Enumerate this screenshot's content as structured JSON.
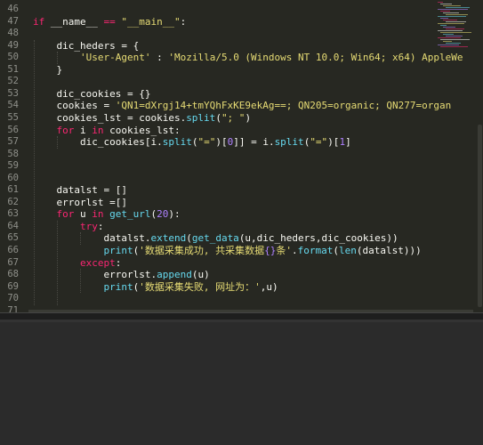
{
  "editor": {
    "lines": [
      {
        "n": "46",
        "segs": []
      },
      {
        "n": "47",
        "segs": [
          {
            "t": "if",
            "c": "kw"
          },
          {
            "t": " __name__ "
          },
          {
            "t": "==",
            "c": "kw"
          },
          {
            "t": " "
          },
          {
            "t": "\"__main__\"",
            "c": "str"
          },
          {
            "t": ":"
          }
        ]
      },
      {
        "n": "48",
        "segs": []
      },
      {
        "n": "49",
        "segs": [
          {
            "t": "    dic_heders = {"
          }
        ]
      },
      {
        "n": "50",
        "segs": [
          {
            "t": "        "
          },
          {
            "t": "'User-Agent'",
            "c": "str"
          },
          {
            "t": " : "
          },
          {
            "t": "'Mozilla/5.0 (Windows NT 10.0; Win64; x64) AppleWe",
            "c": "str"
          }
        ]
      },
      {
        "n": "51",
        "segs": [
          {
            "t": "    }"
          }
        ]
      },
      {
        "n": "52",
        "segs": []
      },
      {
        "n": "53",
        "segs": [
          {
            "t": "    dic_cookies = {}"
          }
        ]
      },
      {
        "n": "54",
        "segs": [
          {
            "t": "    cookies = "
          },
          {
            "t": "'QN1=dXrgj14+tmYQhFxKE9ekAg==; QN205=organic; QN277=organ",
            "c": "str"
          }
        ]
      },
      {
        "n": "55",
        "segs": [
          {
            "t": "    cookies_lst = cookies."
          },
          {
            "t": "split",
            "c": "fn"
          },
          {
            "t": "("
          },
          {
            "t": "\"; \"",
            "c": "str"
          },
          {
            "t": ")"
          }
        ]
      },
      {
        "n": "56",
        "segs": [
          {
            "t": "    "
          },
          {
            "t": "for",
            "c": "kw"
          },
          {
            "t": " i "
          },
          {
            "t": "in",
            "c": "kw"
          },
          {
            "t": " cookies_lst:"
          }
        ]
      },
      {
        "n": "57",
        "segs": [
          {
            "t": "        dic_cookies[i."
          },
          {
            "t": "split",
            "c": "fn"
          },
          {
            "t": "("
          },
          {
            "t": "\"=\"",
            "c": "str"
          },
          {
            "t": ")["
          },
          {
            "t": "0",
            "c": "num"
          },
          {
            "t": "]] = i."
          },
          {
            "t": "split",
            "c": "fn"
          },
          {
            "t": "("
          },
          {
            "t": "\"=\"",
            "c": "str"
          },
          {
            "t": ")["
          },
          {
            "t": "1",
            "c": "num"
          },
          {
            "t": "]"
          }
        ]
      },
      {
        "n": "58",
        "segs": []
      },
      {
        "n": "59",
        "segs": []
      },
      {
        "n": "60",
        "segs": []
      },
      {
        "n": "61",
        "segs": [
          {
            "t": "    datalst = []"
          }
        ]
      },
      {
        "n": "62",
        "segs": [
          {
            "t": "    errorlst =[]"
          }
        ]
      },
      {
        "n": "63",
        "segs": [
          {
            "t": "    "
          },
          {
            "t": "for",
            "c": "kw"
          },
          {
            "t": " u "
          },
          {
            "t": "in",
            "c": "kw"
          },
          {
            "t": " "
          },
          {
            "t": "get_url",
            "c": "fn"
          },
          {
            "t": "("
          },
          {
            "t": "20",
            "c": "num"
          },
          {
            "t": "):"
          }
        ]
      },
      {
        "n": "64",
        "segs": [
          {
            "t": "        "
          },
          {
            "t": "try",
            "c": "kw"
          },
          {
            "t": ":"
          }
        ]
      },
      {
        "n": "65",
        "segs": [
          {
            "t": "            datalst."
          },
          {
            "t": "extend",
            "c": "fn"
          },
          {
            "t": "("
          },
          {
            "t": "get_data",
            "c": "fn"
          },
          {
            "t": "(u,dic_heders,dic_cookies))"
          }
        ]
      },
      {
        "n": "66",
        "segs": [
          {
            "t": "            "
          },
          {
            "t": "print",
            "c": "fn"
          },
          {
            "t": "("
          },
          {
            "t": "'数据采集成功, 共采集数据",
            "c": "str"
          },
          {
            "t": "{}",
            "c": "num"
          },
          {
            "t": "条'",
            "c": "str"
          },
          {
            "t": "."
          },
          {
            "t": "format",
            "c": "fn"
          },
          {
            "t": "("
          },
          {
            "t": "len",
            "c": "fn"
          },
          {
            "t": "(datalst)))"
          }
        ]
      },
      {
        "n": "67",
        "segs": [
          {
            "t": "        "
          },
          {
            "t": "except",
            "c": "kw"
          },
          {
            "t": ":"
          }
        ]
      },
      {
        "n": "68",
        "segs": [
          {
            "t": "            errorlst."
          },
          {
            "t": "append",
            "c": "fn"
          },
          {
            "t": "(u)"
          }
        ]
      },
      {
        "n": "69",
        "segs": [
          {
            "t": "            "
          },
          {
            "t": "print",
            "c": "fn"
          },
          {
            "t": "("
          },
          {
            "t": "'数据采集失败, 网址为：'",
            "c": "str"
          },
          {
            "t": ",u)"
          }
        ]
      },
      {
        "n": "70",
        "segs": []
      },
      {
        "n": "71",
        "segs": []
      }
    ]
  },
  "colors": {
    "editor_bg": "#272822",
    "keyword": "#f92672",
    "string": "#e6db74",
    "number": "#ae81ff",
    "function": "#66d9ef",
    "text": "#f8f8f2",
    "gutter_text": "#8f908a",
    "panel_bg": "#2b2b2b"
  }
}
